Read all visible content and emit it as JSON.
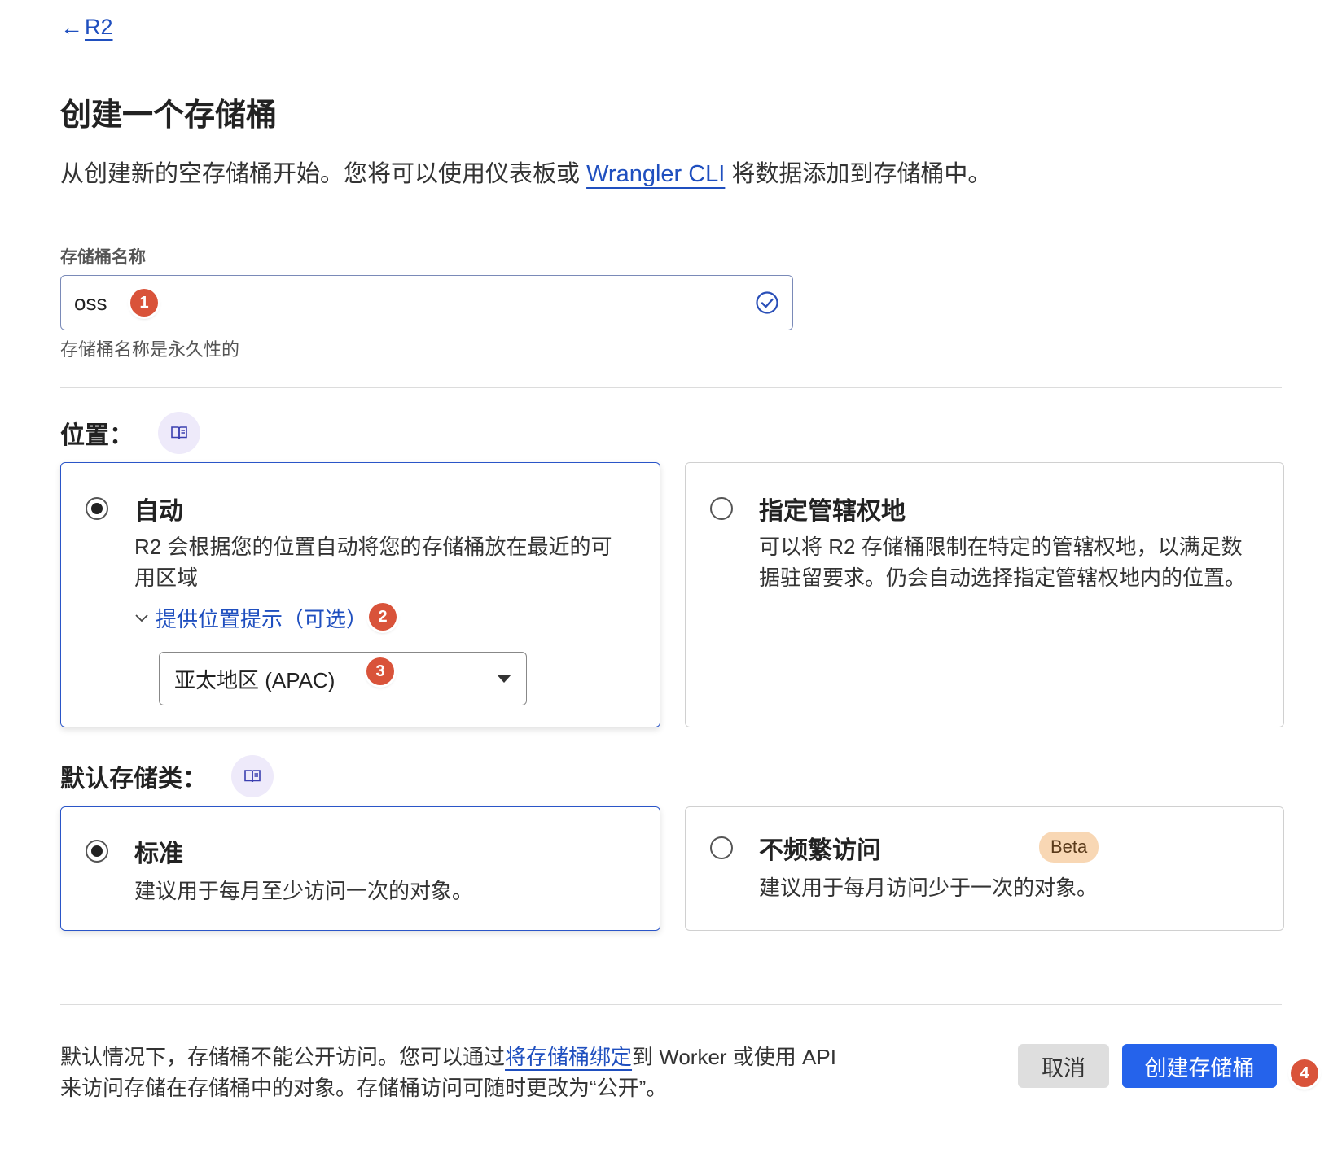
{
  "nav": {
    "back_arrow": "←",
    "back_label": "R2"
  },
  "page": {
    "title": "创建一个存储桶",
    "intro_before": "从创建新的空存储桶开始。您将可以使用仪表板或 ",
    "intro_link": "Wrangler CLI",
    "intro_after": " 将数据添加到存储桶中。"
  },
  "bucket_name": {
    "label": "存储桶名称",
    "value": "oss",
    "hint": "存储桶名称是永久性的",
    "status_icon": "check-circle-icon"
  },
  "location": {
    "title": "位置：",
    "doc_icon": "book-icon",
    "options": [
      {
        "title": "自动",
        "desc": "R2 会根据您的位置自动将您的存储桶放在最近的可用区域",
        "selected": true,
        "hint_toggle": "提供位置提示（可选）",
        "hint_value": "亚太地区 (APAC)"
      },
      {
        "title": "指定管辖权地",
        "desc": "可以将 R2 存储桶限制在特定的管辖权地，以满足数据驻留要求。仍会自动选择指定管辖权地内的位置。",
        "selected": false
      }
    ]
  },
  "storage_class": {
    "title": "默认存储类：",
    "doc_icon": "book-icon",
    "options": [
      {
        "title": "标准",
        "desc": "建议用于每月至少访问一次的对象。",
        "selected": true
      },
      {
        "title": "不频繁访问",
        "badge": "Beta",
        "desc": "建议用于每月访问少于一次的对象。",
        "selected": false
      }
    ]
  },
  "footer": {
    "note_before": "默认情况下，存储桶不能公开访问。您可以通过",
    "note_link": "将存储桶绑定",
    "note_after": "到 Worker 或使用 API 来访问存储在存储桶中的对象。存储桶访问可随时更改为“公开”。",
    "cancel_label": "取消",
    "create_label": "创建存储桶"
  },
  "step_markers": [
    "1",
    "2",
    "3",
    "4"
  ],
  "colors": {
    "accent": "#2563eb",
    "link": "#1f4fbf",
    "marker": "#d9533a",
    "beta_bg": "#f8d7b4"
  }
}
